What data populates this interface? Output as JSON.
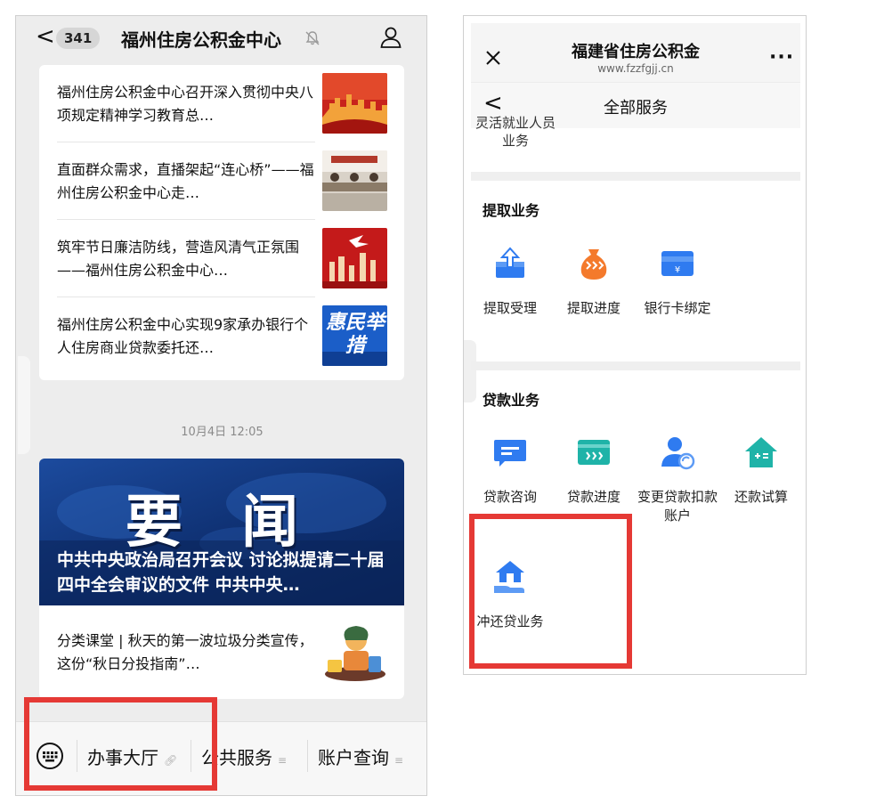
{
  "left_phone": {
    "header": {
      "back_glyph": "<",
      "unread_count": "341",
      "title": "福州住房公积金中心",
      "mute_icon": "bell-muted-icon",
      "profile_icon": "person-icon"
    },
    "news_items": [
      {
        "text": "福州住房公积金中心召开深入贯彻中央八项规定精神学习教育总…"
      },
      {
        "text": "直面群众需求，直播架起“连心桥”——福州住房公积金中心走…"
      },
      {
        "text": "筑牢节日廉洁防线，营造风清气正氛围——福州住房公积金中心…"
      },
      {
        "text": "福州住房公积金中心实现9家承办银行个人住房商业贷款委托还…",
        "thumb_text": "惠民举措"
      }
    ],
    "timestamp": "10月4日 12:05",
    "feature": {
      "banner_big": "要 闻",
      "headline": "中共中央政治局召开会议 讨论拟提请二十届四中全会审议的文件 中共中央…"
    },
    "item5": {
      "text": "分类课堂 | 秋天的第一波垃圾分类宣传，这份“秋日分投指南”…"
    },
    "bottom_menu": {
      "keyboard_icon": "keyboard-icon",
      "items": [
        {
          "label": "办事大厅",
          "glyph": "link-icon"
        },
        {
          "label": "公共服务",
          "glyph": "menu-lines-icon"
        },
        {
          "label": "账户查询",
          "glyph": "menu-lines-icon"
        }
      ]
    },
    "highlight_color": "#e53935"
  },
  "right_phone": {
    "header": {
      "close_icon": "close-icon",
      "title": "福建省住房公积金",
      "url": "www.fzzfgjj.cn",
      "more_glyph": "···",
      "back_glyph": "<",
      "nav_title": "全部服务"
    },
    "prev_item_label": "灵活就业人员业务",
    "sections": [
      {
        "title": "提取业务",
        "items": [
          {
            "label": "提取受理",
            "icon": "upload-tray-icon"
          },
          {
            "label": "提取进度",
            "icon": "money-bag-icon"
          },
          {
            "label": "银行卡绑定",
            "icon": "bank-card-icon"
          }
        ]
      },
      {
        "title": "贷款业务",
        "items": [
          {
            "label": "贷款咨询",
            "icon": "chat-bubble-icon"
          },
          {
            "label": "贷款进度",
            "icon": "card-progress-icon"
          },
          {
            "label": "变更贷款扣款账户",
            "icon": "user-refresh-icon"
          },
          {
            "label": "还款试算",
            "icon": "house-calculator-icon"
          },
          {
            "label": "冲还贷业务",
            "icon": "house-hand-icon"
          }
        ]
      }
    ],
    "accent_blue": "#2f7bf0",
    "accent_orange": "#f47a2c",
    "accent_teal": "#1fb3a8",
    "highlight_color": "#e53935"
  }
}
